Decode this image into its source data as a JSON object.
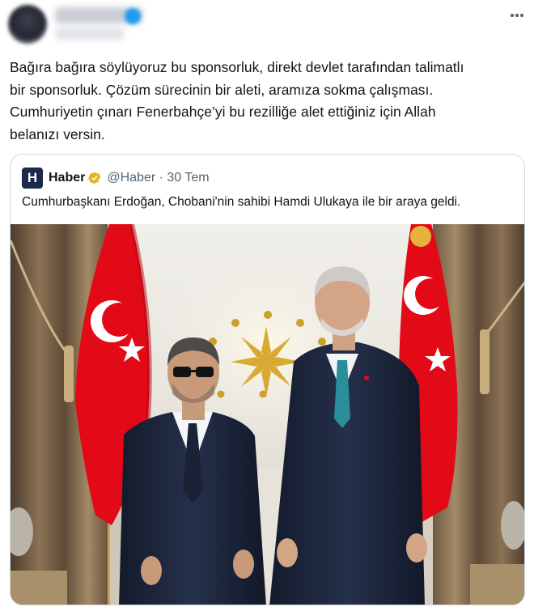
{
  "header": {
    "more_icon": "ellipsis-horizontal-icon"
  },
  "tweet": {
    "lines": [
      "Bağıra bağıra söylüyoruz bu sponsorluk, direkt devlet tarafından talimatlı",
      "bir sponsorluk. Çözüm sürecinin bir aleti, aramıza sokma çalışması.",
      "Cumhuriyetin çınarı Fenerbahçe’yi bu rezilliğe alet ettiğiniz için Allah",
      "belanızı versin."
    ]
  },
  "quote": {
    "logo_letter": "H",
    "name": "Haber",
    "verified_icon": "gold-verified-badge-icon",
    "handle_date": "@Haber · 30 Tem",
    "text": "Cumhurbaşkanı Erdoğan, Chobani'nin sahibi Hamdi Ulukaya ile bir araya geldi.",
    "photo_icon": "news-photo-image"
  },
  "colors": {
    "verified_blue": "#1d9bf0",
    "verified_gold": "#e2b719",
    "flag_red": "#e30a17",
    "logo_navy": "#1b2a4a",
    "muted_text": "#536471",
    "border": "#cfd9de"
  }
}
